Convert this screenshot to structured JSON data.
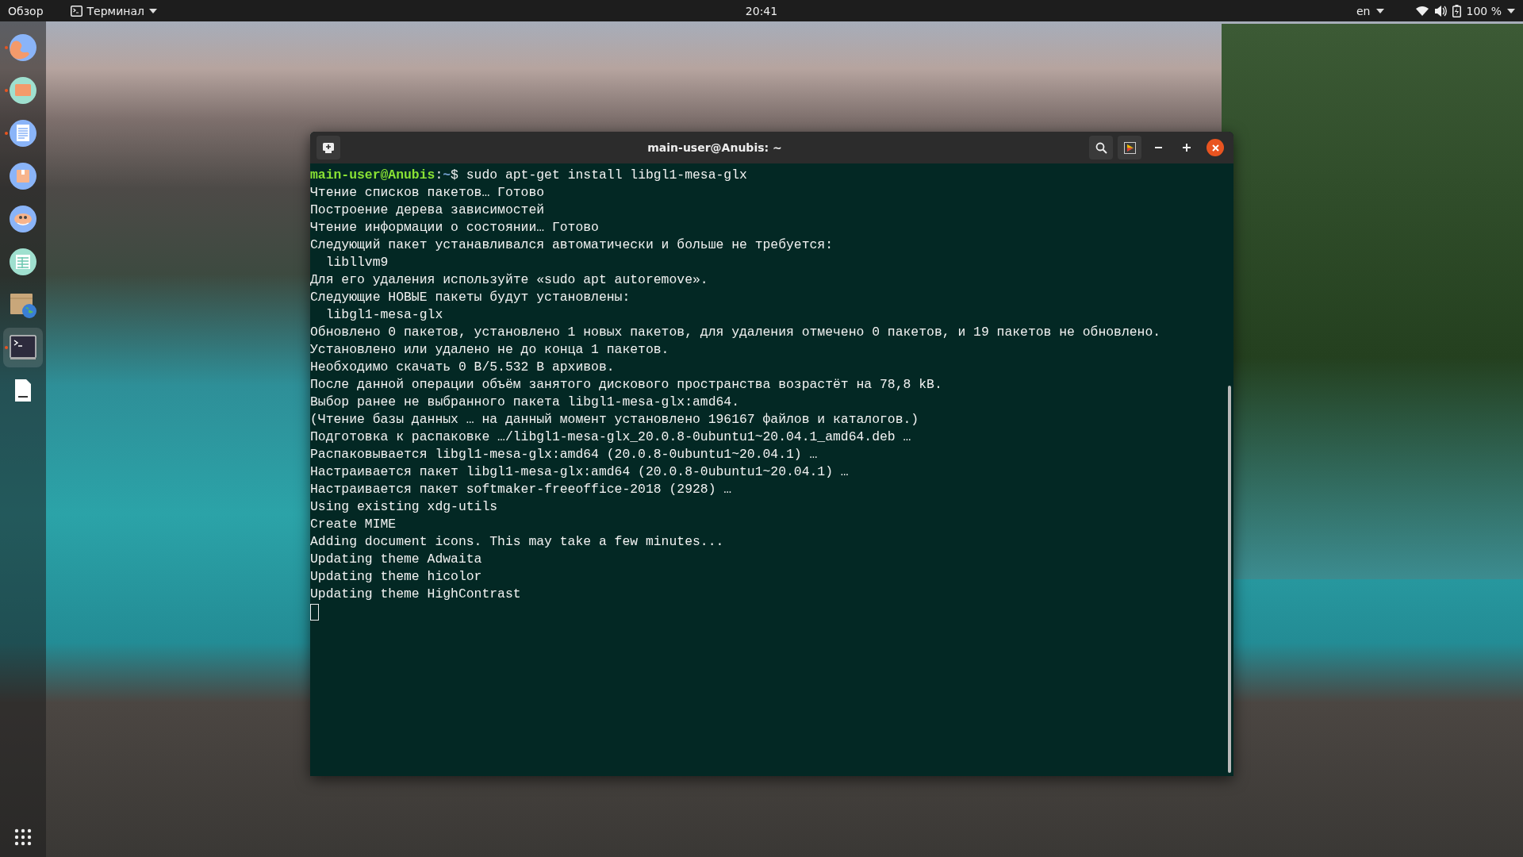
{
  "top_bar": {
    "activities": "Обзор",
    "app_menu": "Терминал",
    "clock": "20:41",
    "language": "en",
    "battery": "100 %"
  },
  "dock": {
    "items": [
      {
        "kind": "browser",
        "running": true,
        "selected": false
      },
      {
        "kind": "files",
        "running": true,
        "selected": false
      },
      {
        "kind": "document",
        "running": true,
        "selected": false
      },
      {
        "kind": "archive",
        "running": false,
        "selected": false
      },
      {
        "kind": "gimp",
        "running": false,
        "selected": false
      },
      {
        "kind": "spreadsheet",
        "running": false,
        "selected": false
      },
      {
        "kind": "package",
        "running": false,
        "selected": false
      },
      {
        "kind": "terminal",
        "running": true,
        "selected": true
      },
      {
        "kind": "textfile",
        "running": false,
        "selected": false
      }
    ]
  },
  "window": {
    "title": "main-user@Anubis: ~",
    "prompt": {
      "user": "main-user@Anubis",
      "separator": ":",
      "path": "~",
      "symbol": "$",
      "command": " sudo apt-get install libgl1-mesa-glx"
    },
    "lines": [
      "Чтение списков пакетов… Готово",
      "Построение дерева зависимостей",
      "Чтение информации о состоянии… Готово",
      "Следующий пакет устанавливался автоматически и больше не требуется:",
      "  libllvm9",
      "Для его удаления используйте «sudo apt autoremove».",
      "Следующие НОВЫЕ пакеты будут установлены:",
      "  libgl1-mesa-glx",
      "Обновлено 0 пакетов, установлено 1 новых пакетов, для удаления отмечено 0 пакетов, и 19 пакетов не обновлено.",
      "Установлено или удалено не до конца 1 пакетов.",
      "Необходимо скачать 0 B/5.532 B архивов.",
      "После данной операции объём занятого дискового пространства возрастёт на 78,8 kB.",
      "Выбор ранее не выбранного пакета libgl1-mesa-glx:amd64.",
      "(Чтение базы данных … на данный момент установлено 196167 файлов и каталогов.)",
      "Подготовка к распаковке …/libgl1-mesa-glx_20.0.8-0ubuntu1~20.04.1_amd64.deb …",
      "Распаковывается libgl1-mesa-glx:amd64 (20.0.8-0ubuntu1~20.04.1) …",
      "Настраивается пакет libgl1-mesa-glx:amd64 (20.0.8-0ubuntu1~20.04.1) …",
      "Настраивается пакет softmaker-freeoffice-2018 (2928) …",
      "Using existing xdg-utils",
      "Create MIME",
      "Adding document icons. This may take a few minutes...",
      "Updating theme Adwaita",
      "Updating theme hicolor",
      "Updating theme HighContrast"
    ]
  }
}
